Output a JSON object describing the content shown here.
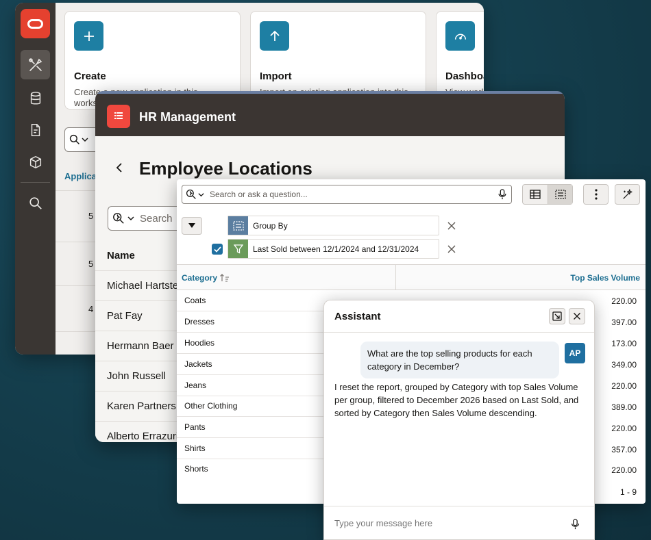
{
  "workspace": {
    "cards": [
      {
        "title": "Create",
        "desc": "Create a new application in this workspace"
      },
      {
        "title": "Import",
        "desc": "Import an existing application into this workspace"
      },
      {
        "title": "Dashboard",
        "desc": "View workspace dashboard"
      }
    ],
    "table_header": "Applications",
    "row_numbers": [
      "5",
      "5",
      "4"
    ]
  },
  "hr_app": {
    "app_title": "HR Management",
    "page_title": "Employee Locations",
    "search_placeholder": "Search",
    "column_name": "Name",
    "employees": [
      "Michael Hartstein",
      "Pat Fay",
      "Hermann Baer",
      "John Russell",
      "Karen Partners",
      "Alberto Errazuriz"
    ]
  },
  "report": {
    "search_placeholder": "Search or ask a question...",
    "filters": [
      {
        "label": "Group By",
        "type": "group"
      },
      {
        "label": "Last Sold between 12/1/2024 and 12/31/2024",
        "type": "filter",
        "checked": true
      }
    ],
    "columns": {
      "category": "Category",
      "volume": "Top Sales Volume"
    },
    "rows": [
      {
        "category": "Coats",
        "volume": "220.00"
      },
      {
        "category": "Dresses",
        "volume": "397.00"
      },
      {
        "category": "Hoodies",
        "volume": "173.00"
      },
      {
        "category": "Jackets",
        "volume": "349.00"
      },
      {
        "category": "Jeans",
        "volume": "220.00"
      },
      {
        "category": "Other Clothing",
        "volume": "389.00"
      },
      {
        "category": "Pants",
        "volume": "220.00"
      },
      {
        "category": "Shirts",
        "volume": "357.00"
      },
      {
        "category": "Shorts",
        "volume": "220.00"
      }
    ],
    "pagination": "1 - 9"
  },
  "assistant": {
    "title": "Assistant",
    "avatar_initials": "AP",
    "user_message": "What are the top selling products for each category in December?",
    "bot_message": "I reset the report, grouped by Category with top Sales Volume per group, filtered to December 2026 based on Last Sold, and sorted by Category then Sales Volume descending.",
    "input_placeholder": "Type your message here"
  },
  "colors": {
    "accent": "#1e7fa3",
    "oracle_red": "#e5412f",
    "header_dark": "#3b3532",
    "link_blue": "#1c6e91"
  },
  "icons": {
    "nav": [
      "oracle-logo",
      "app-builder-icon",
      "database-icon",
      "sql-workshop-icon",
      "gallery-icon",
      "search-icon"
    ],
    "cards": [
      "plus-icon",
      "arrow-up-icon",
      "gauge-icon"
    ]
  }
}
